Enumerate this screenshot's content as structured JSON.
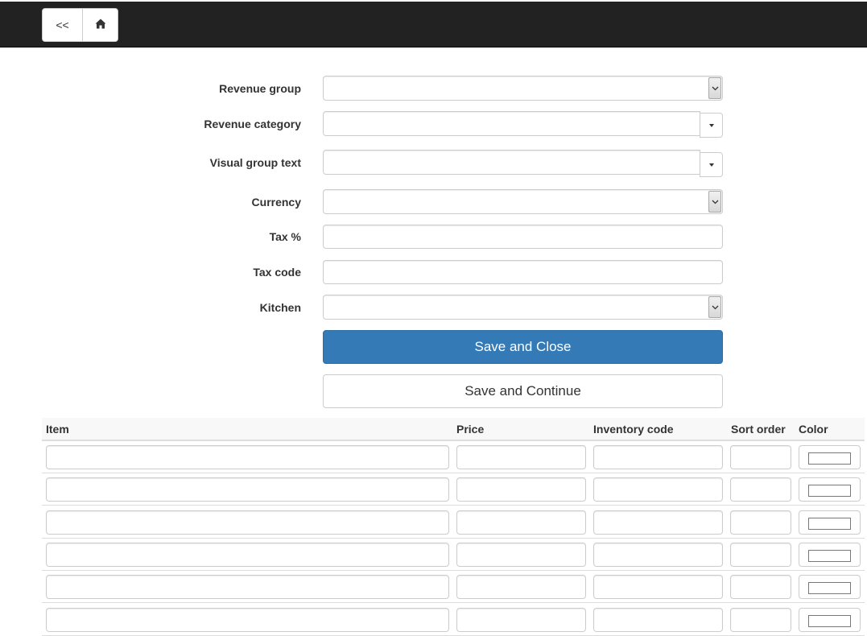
{
  "nav": {
    "back_label": "<<",
    "home_icon": "home-icon"
  },
  "form": {
    "revenue_group": {
      "label": "Revenue group",
      "value": ""
    },
    "revenue_category": {
      "label": "Revenue category",
      "value": ""
    },
    "visual_group_text": {
      "label": "Visual group text",
      "value": ""
    },
    "currency": {
      "label": "Currency",
      "value": ""
    },
    "tax_percent": {
      "label": "Tax %",
      "value": ""
    },
    "tax_code": {
      "label": "Tax code",
      "value": ""
    },
    "kitchen": {
      "label": "Kitchen",
      "value": ""
    }
  },
  "buttons": {
    "save_close": "Save and Close",
    "save_continue": "Save and Continue"
  },
  "table": {
    "headers": [
      "Item",
      "Price",
      "Inventory code",
      "Sort order",
      "Color"
    ],
    "rows": [
      {
        "item": "",
        "price": "",
        "inventory_code": "",
        "sort_order": "",
        "color": "#ffffff"
      },
      {
        "item": "",
        "price": "",
        "inventory_code": "",
        "sort_order": "",
        "color": "#ffffff"
      },
      {
        "item": "",
        "price": "",
        "inventory_code": "",
        "sort_order": "",
        "color": "#ffffff"
      },
      {
        "item": "",
        "price": "",
        "inventory_code": "",
        "sort_order": "",
        "color": "#ffffff"
      },
      {
        "item": "",
        "price": "",
        "inventory_code": "",
        "sort_order": "",
        "color": "#ffffff"
      },
      {
        "item": "",
        "price": "",
        "inventory_code": "",
        "sort_order": "",
        "color": "#ffffff"
      }
    ]
  },
  "colors": {
    "topbar": "#222222",
    "primary": "#337ab7",
    "border": "#cccccc"
  }
}
